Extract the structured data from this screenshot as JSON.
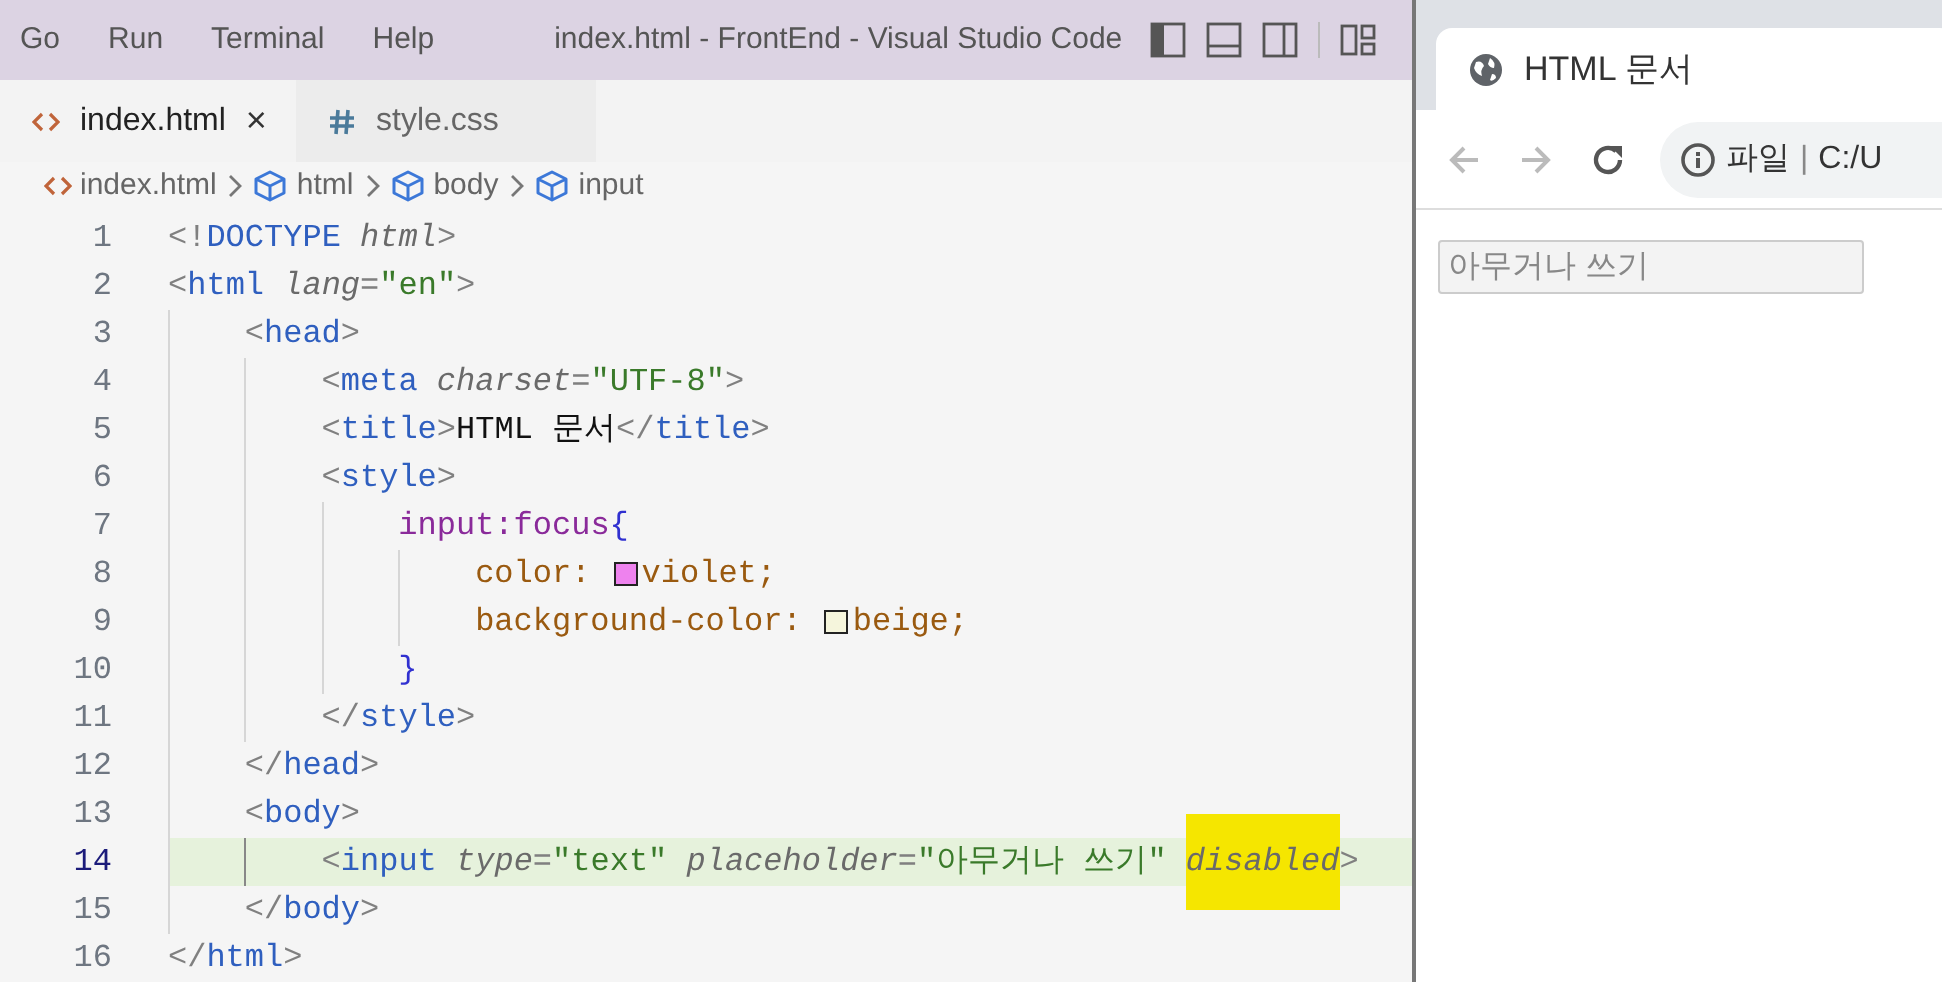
{
  "titlebar": {
    "menu": [
      "Go",
      "Run",
      "Terminal",
      "Help"
    ],
    "title": "index.html - FrontEnd - Visual Studio Code"
  },
  "tabs": [
    {
      "label": "index.html",
      "kind": "html",
      "selected": true,
      "close": "×"
    },
    {
      "label": "style.css",
      "kind": "css",
      "selected": false
    }
  ],
  "breadcrumb": [
    {
      "label": "index.html",
      "kind": "file"
    },
    {
      "label": "html",
      "kind": "element"
    },
    {
      "label": "body",
      "kind": "element"
    },
    {
      "label": "input",
      "kind": "element"
    }
  ],
  "editor": {
    "lines": [
      {
        "number": "1",
        "current": false,
        "tokens": [
          {
            "kind": "punct",
            "text": "<!"
          },
          {
            "kind": "tag",
            "text": "DOCTYPE"
          },
          {
            "kind": "attr",
            "text": " html"
          },
          {
            "kind": "punct",
            "text": ">"
          }
        ]
      },
      {
        "number": "2",
        "current": false,
        "tokens": [
          {
            "kind": "punct",
            "text": "<"
          },
          {
            "kind": "tag",
            "text": "html"
          },
          {
            "kind": "attr",
            "text": " lang"
          },
          {
            "kind": "punct",
            "text": "="
          },
          {
            "kind": "string",
            "text": "\"en\""
          },
          {
            "kind": "punct",
            "text": ">"
          }
        ]
      },
      {
        "number": "3",
        "current": false,
        "tokens": [
          {
            "kind": "punct",
            "text": "    <"
          },
          {
            "kind": "tag",
            "text": "head"
          },
          {
            "kind": "punct",
            "text": ">"
          }
        ]
      },
      {
        "number": "4",
        "current": false,
        "tokens": [
          {
            "kind": "punct",
            "text": "        <"
          },
          {
            "kind": "tag",
            "text": "meta"
          },
          {
            "kind": "attr",
            "text": " charset"
          },
          {
            "kind": "punct",
            "text": "="
          },
          {
            "kind": "string",
            "text": "\"UTF-8\""
          },
          {
            "kind": "punct",
            "text": ">"
          }
        ]
      },
      {
        "number": "5",
        "current": false,
        "tokens": [
          {
            "kind": "punct",
            "text": "        <"
          },
          {
            "kind": "tag",
            "text": "title"
          },
          {
            "kind": "punct",
            "text": ">"
          },
          {
            "kind": "plain",
            "text": "HTML 문서"
          },
          {
            "kind": "punct",
            "text": "</"
          },
          {
            "kind": "tag",
            "text": "title"
          },
          {
            "kind": "punct",
            "text": ">"
          }
        ]
      },
      {
        "number": "6",
        "current": false,
        "tokens": [
          {
            "kind": "punct",
            "text": "        <"
          },
          {
            "kind": "tag",
            "text": "style"
          },
          {
            "kind": "punct",
            "text": ">"
          }
        ]
      },
      {
        "number": "7",
        "current": false,
        "tokens": [
          {
            "kind": "selector",
            "text": "            input:focus"
          },
          {
            "kind": "brace",
            "text": "{"
          }
        ]
      },
      {
        "number": "8",
        "current": false,
        "tokens": [
          {
            "kind": "property",
            "text": "                color: "
          },
          {
            "kind": "swatch",
            "color": "#ee82ee"
          },
          {
            "kind": "property",
            "text": "violet;"
          }
        ]
      },
      {
        "number": "9",
        "current": false,
        "tokens": [
          {
            "kind": "property",
            "text": "                background-color: "
          },
          {
            "kind": "swatch",
            "color": "#f5f5dc"
          },
          {
            "kind": "property",
            "text": "beige;"
          }
        ]
      },
      {
        "number": "10",
        "current": false,
        "tokens": [
          {
            "kind": "brace",
            "text": "            }"
          }
        ]
      },
      {
        "number": "11",
        "current": false,
        "tokens": [
          {
            "kind": "punct",
            "text": "        </"
          },
          {
            "kind": "tag",
            "text": "style"
          },
          {
            "kind": "punct",
            "text": ">"
          }
        ]
      },
      {
        "number": "12",
        "current": false,
        "tokens": [
          {
            "kind": "punct",
            "text": "    </"
          },
          {
            "kind": "tag",
            "text": "head"
          },
          {
            "kind": "punct",
            "text": ">"
          }
        ]
      },
      {
        "number": "13",
        "current": false,
        "tokens": [
          {
            "kind": "punct",
            "text": "    <"
          },
          {
            "kind": "tag",
            "text": "body"
          },
          {
            "kind": "punct",
            "text": ">"
          }
        ]
      },
      {
        "number": "14",
        "current": true,
        "tokens": [
          {
            "kind": "punct",
            "text": "        <"
          },
          {
            "kind": "tag",
            "text": "input"
          },
          {
            "kind": "attr",
            "text": " type"
          },
          {
            "kind": "punct",
            "text": "="
          },
          {
            "kind": "string",
            "text": "\"text\""
          },
          {
            "kind": "attr",
            "text": " placeholder"
          },
          {
            "kind": "punct",
            "text": "="
          },
          {
            "kind": "string",
            "text": "\"아무거나 쓰기\""
          },
          {
            "kind": "highlighted-attr",
            "text": " disabled"
          },
          {
            "kind": "punct",
            "text": ">"
          }
        ]
      },
      {
        "number": "15",
        "current": false,
        "tokens": [
          {
            "kind": "punct",
            "text": "    </"
          },
          {
            "kind": "tag",
            "text": "body"
          },
          {
            "kind": "punct",
            "text": ">"
          }
        ]
      },
      {
        "number": "16",
        "current": false,
        "tokens": [
          {
            "kind": "punct",
            "text": "</"
          },
          {
            "kind": "tag",
            "text": "html"
          },
          {
            "kind": "punct",
            "text": ">"
          }
        ]
      }
    ]
  },
  "browser": {
    "tab_title": "HTML 문서",
    "address": {
      "scheme": "파일",
      "separator": "|",
      "url": "C:/U"
    },
    "page": {
      "input": {
        "placeholder": "아무거나 쓰기",
        "disabled": true
      }
    }
  }
}
